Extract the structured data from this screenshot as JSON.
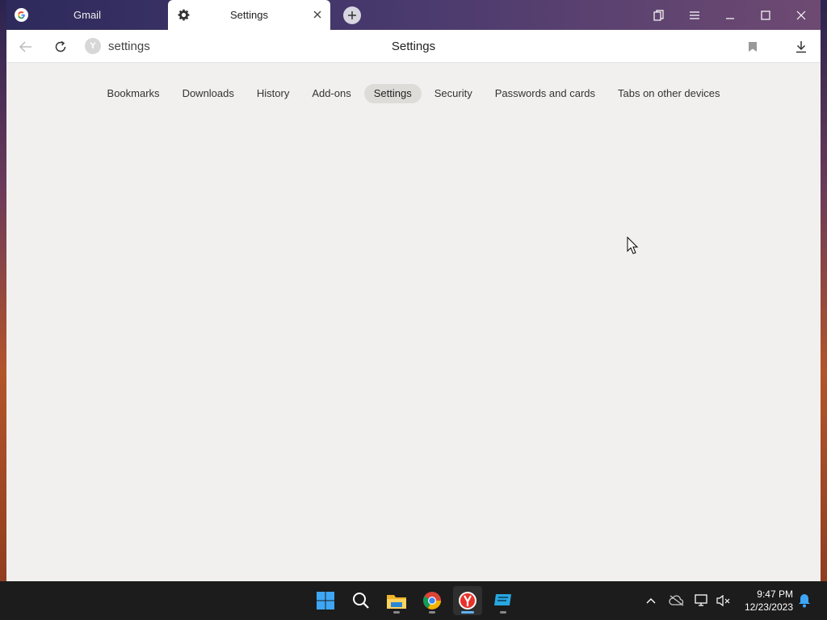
{
  "tabs": [
    {
      "title": "Gmail",
      "icon": "google-icon",
      "active": false
    },
    {
      "title": "Settings",
      "icon": "gear-icon",
      "active": true
    }
  ],
  "toolbar": {
    "address_badge": "Y",
    "address_text": "settings",
    "page_title": "Settings"
  },
  "nav": {
    "items": [
      {
        "label": "Bookmarks",
        "active": false
      },
      {
        "label": "Downloads",
        "active": false
      },
      {
        "label": "History",
        "active": false
      },
      {
        "label": "Add-ons",
        "active": false
      },
      {
        "label": "Settings",
        "active": true
      },
      {
        "label": "Security",
        "active": false
      },
      {
        "label": "Passwords and cards",
        "active": false
      },
      {
        "label": "Tabs on other devices",
        "active": false
      }
    ]
  },
  "taskbar": {
    "apps": [
      "windows-start-icon",
      "search-icon",
      "file-explorer-icon",
      "chrome-icon",
      "yandex-browser-icon",
      "app-icon"
    ],
    "time": "9:47 PM",
    "date": "12/23/2023"
  },
  "colors": {
    "accent": "#5fb2f2",
    "active_pill": "#dedcd9",
    "page_bg": "#f1f0ee"
  }
}
